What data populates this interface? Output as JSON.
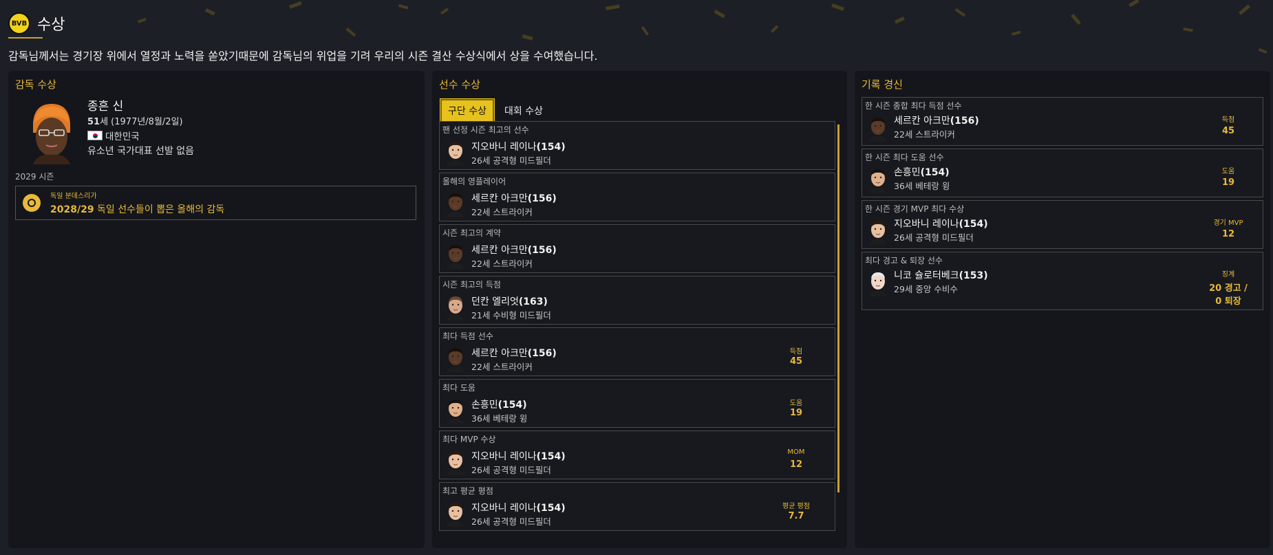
{
  "header": {
    "club_logo_text": "BVB",
    "title": "수상",
    "intro": "감독님께서는 경기장 위에서 열정과 노력을 쏟았기때문에 감독님의 위업을 기려 우리의 시즌 결산 수상식에서 상을 수여했습니다."
  },
  "manager_panel": {
    "title": "감독 수상",
    "name": "종흔 신",
    "age": "51",
    "age_suffix": "세 (1977년/8월/2일)",
    "nation": "대한민국",
    "international": "유소년 국가대표 선발 없음",
    "season": "2029 시즌",
    "award": {
      "competition": "독일 분데스리가",
      "year": "2028/29",
      "desc": " 독일 선수들이 뽑은 올해의 감독"
    }
  },
  "player_panel": {
    "title": "선수 수상",
    "tabs": [
      "구단 수상",
      "대회 수상"
    ],
    "awards": [
      {
        "title": "팬 선정 시즌 최고의 선수",
        "name": "지오바니 레이나",
        "ca": "(154)",
        "pos": "26세 공격형 미드필더",
        "stat_label": "",
        "stat_value": "",
        "face": "pale"
      },
      {
        "title": "올해의 영플레이어",
        "name": "세르칸 아크만",
        "ca": "(156)",
        "pos": "22세 스트라이커",
        "stat_label": "",
        "stat_value": "",
        "face": "dark"
      },
      {
        "title": "시즌 최고의 계약",
        "name": "세르칸 아크만",
        "ca": "(156)",
        "pos": "22세 스트라이커",
        "stat_label": "",
        "stat_value": "",
        "face": "dark"
      },
      {
        "title": "시즌 최고의 득점",
        "name": "던칸 엘리엇",
        "ca": "(163)",
        "pos": "21세 수비형 미드필더",
        "stat_label": "",
        "stat_value": "",
        "face": "light"
      },
      {
        "title": "최다 득점 선수",
        "name": "세르칸 아크만",
        "ca": "(156)",
        "pos": "22세 스트라이커",
        "stat_label": "득점",
        "stat_value": "45",
        "face": "dark"
      },
      {
        "title": "최다 도움",
        "name": "손흥민",
        "ca": "(154)",
        "pos": "36세 베테랑 윙",
        "stat_label": "도움",
        "stat_value": "19",
        "face": "asian"
      },
      {
        "title": "최다 MVP 수상",
        "name": "지오바니 레이나",
        "ca": "(154)",
        "pos": "26세 공격형 미드필더",
        "stat_label": "MOM",
        "stat_value": "12",
        "face": "pale"
      },
      {
        "title": "최고 평균 평점",
        "name": "지오바니 레이나",
        "ca": "(154)",
        "pos": "26세 공격형 미드필더",
        "stat_label": "평균 평점",
        "stat_value": "7.7",
        "face": "pale"
      }
    ]
  },
  "records_panel": {
    "title": "기록 경신",
    "records": [
      {
        "title": "한 시즌 종합 최다 득점 선수",
        "name": "세르칸 아크만",
        "ca": "(156)",
        "pos": "22세 스트라이커",
        "stat_label": "득점",
        "stat_value": "45",
        "face": "dark"
      },
      {
        "title": "한 시즌 최다 도움 선수",
        "name": "손흥민",
        "ca": "(154)",
        "pos": "36세 베테랑 윙",
        "stat_label": "도움",
        "stat_value": "19",
        "face": "asian"
      },
      {
        "title": "한 시즌 경기 MVP 최다 수상",
        "name": "지오바니 레이나",
        "ca": "(154)",
        "pos": "26세 공격형 미드필더",
        "stat_label": "경기 MVP",
        "stat_value": "12",
        "face": "pale"
      },
      {
        "title": "최다 경고 & 퇴장 선수",
        "name": "니코 슐로터베크",
        "ca": "(153)",
        "pos": "29세 중앙 수비수",
        "stat_label": "징계",
        "stat_value": "20 경고 /",
        "stat_value2": "0 퇴장",
        "face": "white"
      }
    ]
  },
  "colors": {
    "background": "#1d1f26",
    "panel": "#14161b",
    "accent": "#e8b93a",
    "tab_active": "#e8c21c"
  }
}
